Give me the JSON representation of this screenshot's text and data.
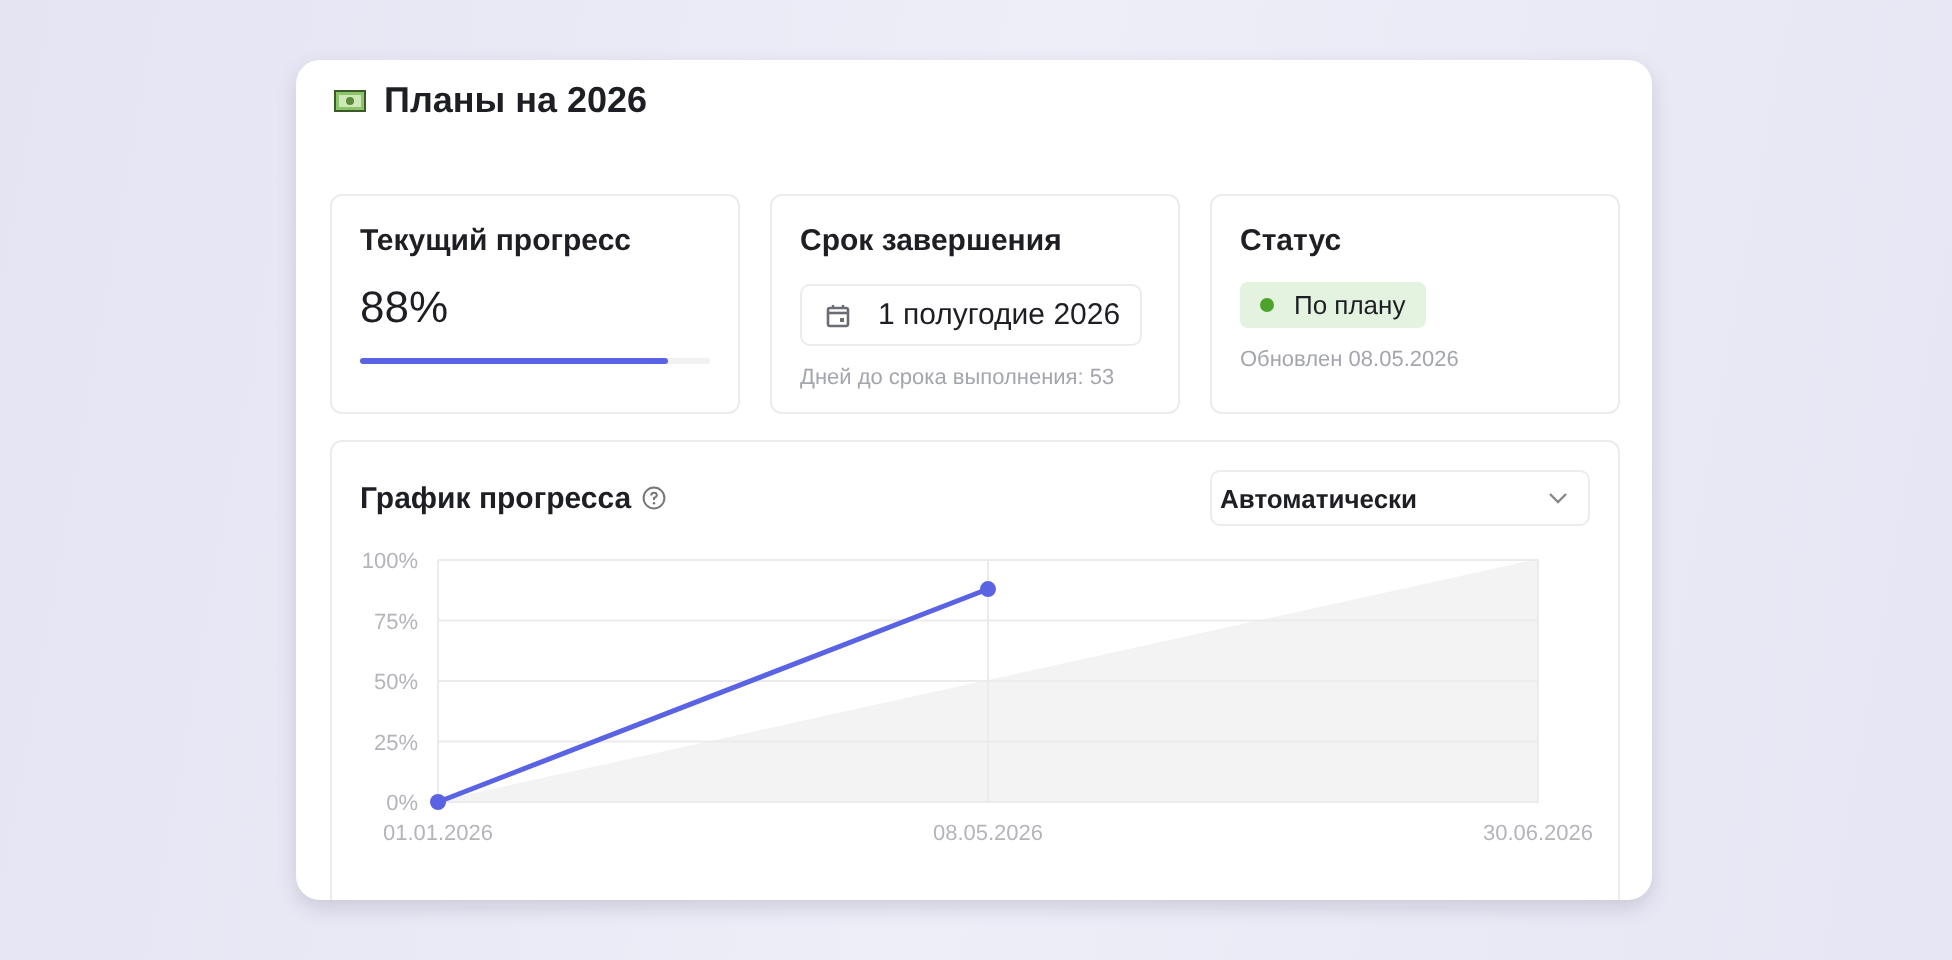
{
  "title": "Планы на 2026",
  "stats": [
    {
      "kind": "progress",
      "label": "Текущий прогресс",
      "value": "88%",
      "level": 0.88
    },
    {
      "kind": "deadline",
      "label": "Срок завершения",
      "date": "1 полугодие 2026",
      "note": "Дней до срока выполнения: 53"
    },
    {
      "kind": "status",
      "label": "Статус",
      "badge": "По плану",
      "color": "#4ca22a",
      "note": "Обновлен 08.05.2026"
    }
  ],
  "chart_panel": {
    "title": "График прогресса",
    "mode_select": {
      "value": "Автоматически"
    },
    "chart_data": {
      "type": "line",
      "grid": true,
      "categories": [
        "01.01.2026",
        "08.05.2026",
        "30.06.2026"
      ],
      "ylim": [
        0,
        100
      ],
      "yticks": [
        {
          "value": 0,
          "label": "0%"
        },
        {
          "value": 25,
          "label": "25%"
        },
        {
          "value": 50,
          "label": "50%"
        },
        {
          "value": 75,
          "label": "75%"
        },
        {
          "value": 100,
          "label": "100%"
        }
      ],
      "series": [
        {
          "type": "area",
          "color": "#f3f3f3",
          "values": [
            0,
            50,
            100
          ]
        },
        {
          "type": "line",
          "color": "#5a63e3",
          "marker": true,
          "values": [
            0,
            88,
            null
          ]
        }
      ]
    }
  }
}
